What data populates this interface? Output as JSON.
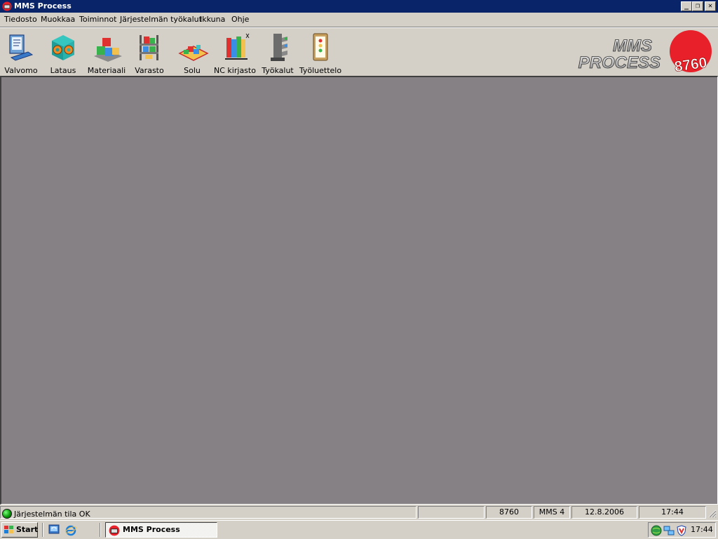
{
  "window": {
    "title": "MMS Process",
    "minimize_glyph": "_",
    "maximize_glyph": "❐",
    "close_glyph": "✕"
  },
  "menu": {
    "items": [
      "Tiedosto",
      "Muokkaa",
      "Toiminnot",
      "Järjestelmän työkalut",
      "Ikkuna",
      "Ohje"
    ]
  },
  "toolbar": {
    "buttons": [
      {
        "label": "Valvomo",
        "icon": "monitor-icon"
      },
      {
        "label": "Lataus",
        "icon": "loading-icon"
      },
      {
        "label": "Materiaali",
        "icon": "material-blocks-icon"
      },
      {
        "label": "Varasto",
        "icon": "storage-rack-icon"
      },
      {
        "label": "Solu",
        "icon": "cell-icon"
      },
      {
        "label": "NC kirjasto",
        "icon": "nc-library-icon"
      },
      {
        "label": "Työkalut",
        "icon": "tools-icon"
      },
      {
        "label": "Työluettelo",
        "icon": "work-list-icon"
      }
    ]
  },
  "logo": {
    "line1": "MMS",
    "line2": "PROCESS",
    "badge": "8760",
    "badge_color": "#e8202a"
  },
  "statusbar": {
    "system_status": "Järjestelmän tila OK",
    "empty": "",
    "machine": "8760",
    "version": "MMS 4",
    "date": "12.8.2006",
    "time": "17:44"
  },
  "taskbar": {
    "start_label": "Start",
    "task_label": "MMS Process",
    "clock": "17:44"
  },
  "colors": {
    "titlebar": "#0a246a",
    "workspace": "#858185",
    "status_ok": "#0a9a0a"
  }
}
